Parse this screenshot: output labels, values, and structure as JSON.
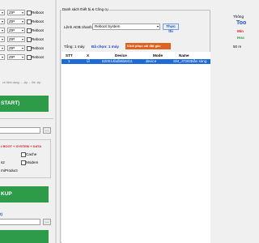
{
  "left": {
    "rows": [
      {
        "value": "ZIP",
        "label": "Reboot"
      },
      {
        "value": "ZIP",
        "label": "Reboot"
      },
      {
        "value": "ZIP",
        "label": "Reboot"
      },
      {
        "value": "ZIP",
        "label": "Reboot"
      },
      {
        "value": "ZIP",
        "label": "Reboot"
      },
      {
        "value": "ZIP",
        "label": "Reboot"
      }
    ],
    "hint": "ch định dạng ... .zip ... file .zip",
    "start_label": "START)",
    "browse_label": "...",
    "backup_hint": "t BOOT + SYSTEM + DATA",
    "cache_label": "Cache",
    "modem_label": "Modem",
    "s2_label": "s2",
    "product_label": "miProduct",
    "backup_label": "KUP",
    "bottom_label": "t)",
    "bottom_browse": "..."
  },
  "main": {
    "group_title": "Danh sách thiết bị & Công cụ",
    "adb_label": "Lệnh ADB nhanh:",
    "adb_value": "Reboot System",
    "run_label": "Thực thi",
    "total_text": "Tổng: 1 máy",
    "selected_text": "Đã chọn: 1 máy",
    "restore_label": "Khôi phục cài đặt gốc",
    "columns": [
      "STT",
      "X",
      "Device",
      "Mode",
      "Name"
    ],
    "rows": [
      {
        "stt": "1",
        "x": "☑",
        "device": "520014bdb6b8411",
        "mode": "device",
        "name": "SM_J730G",
        "status": "Sẵn sàng"
      }
    ]
  },
  "right_panel": {
    "title": "Thông",
    "line1": "Too",
    "line2": "Min",
    "line3": "Hoa",
    "count_text": "50 m"
  },
  "colors": {
    "green": "#2d9b47",
    "selection": "#1e6ad8",
    "selected_text": "#1a3fd6",
    "restore_btn": "#e0621f",
    "backup_red": "#d61f1f",
    "brand_blue": "#1f4fb0"
  }
}
